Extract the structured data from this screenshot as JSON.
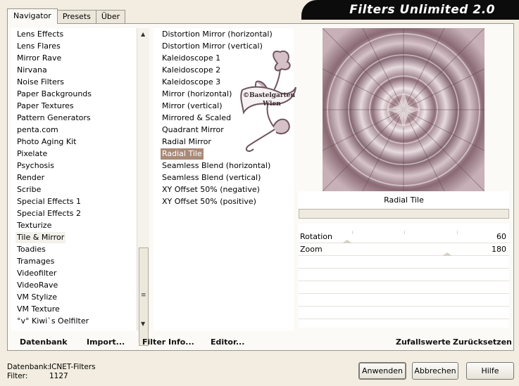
{
  "tabs": [
    {
      "label": "Navigator",
      "active": true
    },
    {
      "label": "Presets",
      "active": false
    },
    {
      "label": "Über",
      "active": false
    }
  ],
  "banner": {
    "title": "Filters Unlimited 2.0"
  },
  "categories": [
    "Lens Effects",
    "Lens Flares",
    "Mirror Rave",
    "Nirvana",
    "Noise Filters",
    "Paper Backgrounds",
    "Paper Textures",
    "Pattern Generators",
    "penta.com",
    "Photo Aging Kit",
    "Pixelate",
    "Psychosis",
    "Render",
    "Scribe",
    "Special Effects 1",
    "Special Effects 2",
    "Texturize",
    "Tile & Mirror",
    "Toadies",
    "Tramages",
    "Videofilter",
    "VideoRave",
    "VM Stylize",
    "VM Texture",
    "°v° Kiwi`s Oelfilter"
  ],
  "selected_category": "Tile & Mirror",
  "filters": [
    "Distortion Mirror (horizontal)",
    "Distortion Mirror (vertical)",
    "Kaleidoscope 1",
    "Kaleidoscope 2",
    "Kaleidoscope 3",
    "Mirror (horizontal)",
    "Mirror (vertical)",
    "Mirrored & Scaled",
    "Quadrant Mirror",
    "Radial Mirror",
    "Radial Tile",
    "Seamless Blend (horizontal)",
    "Seamless Blend (vertical)",
    "XY Offset 50% (negative)",
    "XY Offset 50% (positive)"
  ],
  "selected_filter": "Radial Tile",
  "preview": {
    "filter_name": "Radial Tile"
  },
  "params": [
    {
      "label": "Rotation",
      "value": "60"
    },
    {
      "label": "Zoom",
      "value": "180"
    }
  ],
  "watermark": {
    "line1": "©Bastelgarten",
    "line2": "Wien"
  },
  "bottom_links": {
    "datenbank": "Datenbank",
    "import": "Import...",
    "filter_info": "Filter Info...",
    "editor": "Editor...",
    "zufallswerte": "Zufallswerte",
    "zuruecksetzen": "Zurücksetzen"
  },
  "status": {
    "db_label": "Datenbank:",
    "db_value": "ICNET-Filters",
    "filter_label": "Filter:",
    "filter_value": "1127"
  },
  "buttons": {
    "apply": "Anwenden",
    "cancel": "Abbrechen",
    "help": "Hilfe"
  },
  "colors": {
    "selection": "#a98a78",
    "preview_base": "#8b6b73",
    "banner": "#0c0c0c"
  }
}
